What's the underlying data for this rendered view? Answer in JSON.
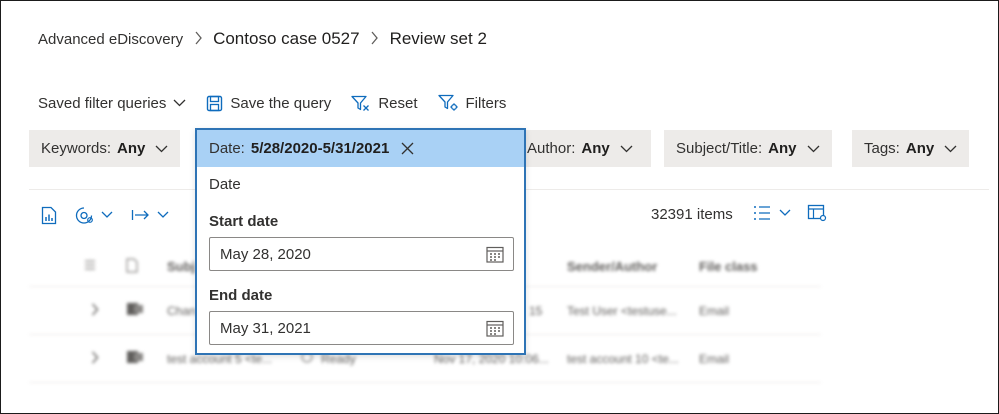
{
  "breadcrumb": {
    "root": "Advanced eDiscovery",
    "case": "Contoso case 0527",
    "review_set": "Review set 2"
  },
  "toolbar": {
    "saved_filter_queries": "Saved filter queries",
    "save_query": "Save the query",
    "reset": "Reset",
    "filters": "Filters"
  },
  "filters": {
    "keywords": {
      "label": "Keywords:",
      "value": "Any"
    },
    "date": {
      "label": "Date:",
      "value": "5/28/2020-5/31/2021"
    },
    "author": {
      "label": "Author:",
      "value": "Any"
    },
    "subject": {
      "label": "Subject/Title:",
      "value": "Any"
    },
    "tags": {
      "label": "Tags:",
      "value": "Any"
    }
  },
  "date_popup": {
    "title": "Date",
    "start_label": "Start date",
    "start_value": "May 28, 2020",
    "end_label": "End date",
    "end_value": "May 31, 2021"
  },
  "list": {
    "items_count": "32391 items",
    "columns": {
      "subject": "Subj",
      "sender": "Sender/Author",
      "file_class": "File class"
    },
    "rows": [
      {
        "subject": "Chan",
        "status": "",
        "date": "15",
        "sender": "Test User <testuse...",
        "file_class": "Email"
      },
      {
        "subject": "test account 5 <te...",
        "status": "Ready",
        "date": "Nov 17, 2020 10:06...",
        "sender": "test account 10 <te...",
        "file_class": "Email"
      }
    ]
  },
  "colors": {
    "accent": "#2f74b5",
    "chip_bg": "#edebe9",
    "active_chip_bg": "#a9d1f5",
    "icon_blue": "#0f6cbd"
  }
}
